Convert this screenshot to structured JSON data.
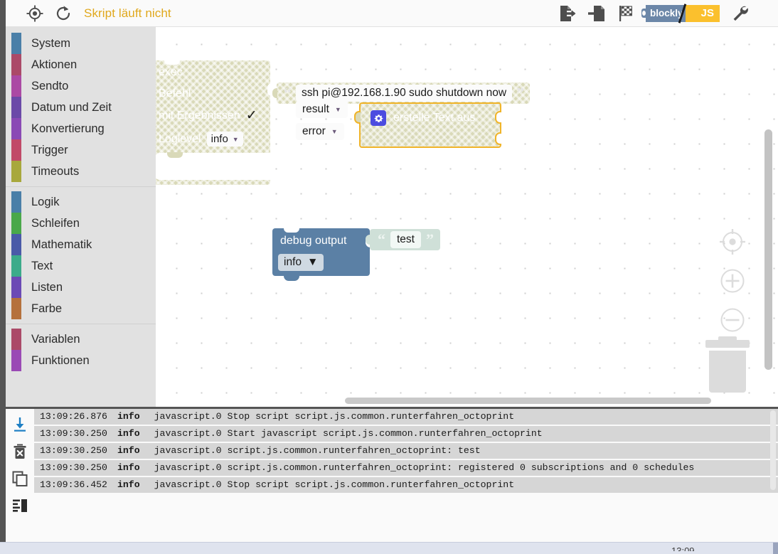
{
  "header": {
    "locate_icon": "target-crosshair-icon",
    "reload_icon": "reload-icon",
    "status_text": "Skript läuft nicht",
    "status_color": "#e0a81c",
    "export_icon": "export-blocks-icon",
    "import_icon": "import-blocks-icon",
    "checkered_flag_icon": "checkered-flag-icon",
    "lang_blockly_label": "blockly",
    "lang_js_label": "JS",
    "settings_icon": "wrench-icon"
  },
  "toolbox": {
    "groups": [
      {
        "items": [
          {
            "label": "System",
            "color": "#4a7fa8"
          },
          {
            "label": "Aktionen",
            "color": "#ab4a68"
          },
          {
            "label": "Sendto",
            "color": "#ab4aa4"
          },
          {
            "label": "Datum und Zeit",
            "color": "#6b4aa8"
          },
          {
            "label": "Konvertierung",
            "color": "#8a4ab5"
          },
          {
            "label": "Trigger",
            "color": "#c14a68"
          },
          {
            "label": "Timeouts",
            "color": "#a8a83c"
          }
        ]
      },
      {
        "items": [
          {
            "label": "Logik",
            "color": "#4a7fa8"
          },
          {
            "label": "Schleifen",
            "color": "#4aa84a"
          },
          {
            "label": "Mathematik",
            "color": "#4a5aa8"
          },
          {
            "label": "Text",
            "color": "#3cab8a"
          },
          {
            "label": "Listen",
            "color": "#6b4ab5"
          },
          {
            "label": "Farbe",
            "color": "#b5713c"
          }
        ]
      },
      {
        "items": [
          {
            "label": "Variablen",
            "color": "#ab4a68"
          },
          {
            "label": "Funktionen",
            "color": "#9a4ab5"
          }
        ]
      }
    ]
  },
  "workspace": {
    "exec_block": {
      "title": "exec",
      "command_label": "Befehl",
      "with_results_label": "mit Ergebnissen",
      "with_results_checked": "✓",
      "loglevel_label": "Loglevel",
      "loglevel_value": "info",
      "caret": "▼"
    },
    "command_text_block": {
      "open_quote": "“",
      "value": "ssh pi@192.168.1.90 sudo shutdown now",
      "close_quote": "”"
    },
    "join_block": {
      "gear_icon": "gear-icon",
      "label": "erstelle Text aus",
      "input_1_value": "result",
      "input_2_value": "error",
      "caret": "▼"
    },
    "debug_block": {
      "title": "debug output",
      "level_value": "info",
      "caret": "▼"
    },
    "debug_text_block": {
      "open_quote": "“",
      "value": "test",
      "close_quote": "”"
    },
    "controls": {
      "center_icon": "center-workspace-icon",
      "zoom_in_icon": "zoom-in-icon",
      "zoom_out_icon": "zoom-out-icon",
      "trash_icon": "trash-can-icon"
    }
  },
  "console": {
    "tools": [
      {
        "icon": "download-log-icon"
      },
      {
        "icon": "delete-log-icon"
      },
      {
        "icon": "copy-log-icon"
      },
      {
        "icon": "layout-log-icon"
      }
    ],
    "rows": [
      {
        "time": "13:09:26.876",
        "severity": "info",
        "message": "javascript.0 Stop script script.js.common.runterfahren_octoprint"
      },
      {
        "time": "13:09:30.250",
        "severity": "info",
        "message": "javascript.0 Start javascript script.js.common.runterfahren_octoprint"
      },
      {
        "time": "13:09:30.250",
        "severity": "info",
        "message": "javascript.0 script.js.common.runterfahren_octoprint: test"
      },
      {
        "time": "13:09:30.250",
        "severity": "info",
        "message": "javascript.0 script.js.common.runterfahren_octoprint: registered 0 subscriptions and 0 schedules"
      },
      {
        "time": "13:09:36.452",
        "severity": "info",
        "message": "javascript.0 Stop script script.js.common.runterfahren_octoprint"
      }
    ]
  },
  "bottom_bar": {
    "clock": "13:09"
  }
}
